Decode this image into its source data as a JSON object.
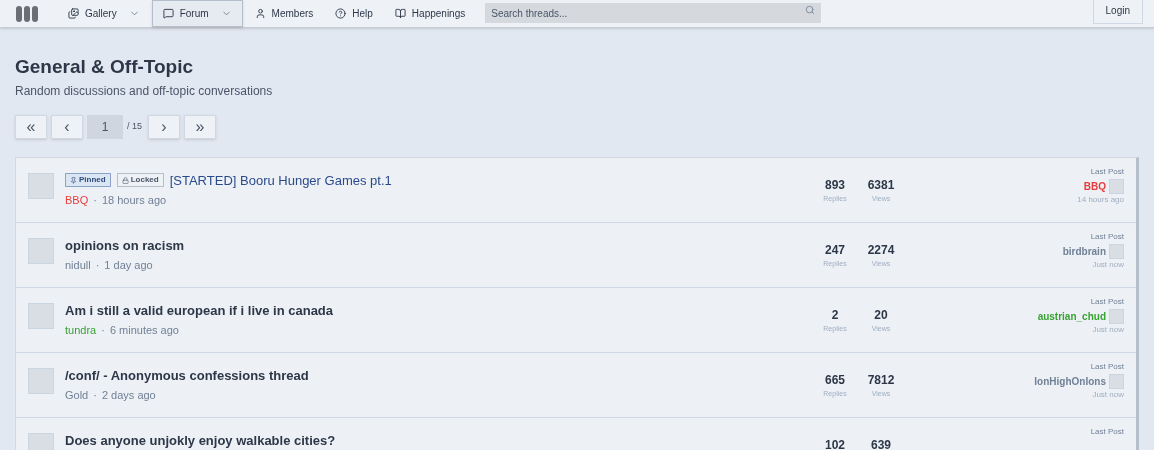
{
  "nav": {
    "items": [
      {
        "label": "Gallery",
        "dropdown": true,
        "selected": false
      },
      {
        "label": "Forum",
        "dropdown": true,
        "selected": true
      },
      {
        "label": "Members",
        "dropdown": false,
        "selected": false
      },
      {
        "label": "Help",
        "dropdown": false,
        "selected": false
      },
      {
        "label": "Happenings",
        "dropdown": false,
        "selected": false
      }
    ],
    "search": {
      "placeholder": "Search threads..."
    },
    "login": "Login"
  },
  "header": {
    "title": "General & Off-Topic",
    "subtitle": "Random discussions and off-topic conversations"
  },
  "pagination": {
    "first": "«",
    "prev": "‹",
    "current": "1",
    "total": "/ 15",
    "next": "›",
    "last": "»"
  },
  "threads": [
    {
      "badges": [
        {
          "kind": "pinned",
          "label": "Pinned"
        },
        {
          "kind": "locked",
          "label": "Locked"
        }
      ],
      "title": "[STARTED] Booru Hunger Games pt.1",
      "unread": false,
      "author": {
        "name": "BBQ",
        "color": "#e53e3e"
      },
      "sep": "·",
      "time": "18 hours ago",
      "replies": "893",
      "replies_label": "Replies",
      "views": "6381",
      "views_label": "Views",
      "last_label": "Last Post",
      "last_user": {
        "name": "BBQ",
        "color": "#e53e3e"
      },
      "last_time": "14 hours ago"
    },
    {
      "title": "opinions on racism",
      "unread": true,
      "author": {
        "name": "nidull",
        "color": "#718096"
      },
      "sep": "·",
      "time": "1 day ago",
      "replies": "247",
      "replies_label": "Replies",
      "views": "2274",
      "views_label": "Views",
      "last_label": "Last Post",
      "last_user": {
        "name": "birdbrain",
        "color": "#718096"
      },
      "last_time": "Just now"
    },
    {
      "title": "Am i still a valid european if i live in canada",
      "unread": true,
      "author": {
        "name": "tundra",
        "color": "#38a132"
      },
      "sep": "·",
      "time": "6 minutes ago",
      "replies": "2",
      "replies_label": "Replies",
      "views": "20",
      "views_label": "Views",
      "last_label": "Last Post",
      "last_user": {
        "name": "austrian_chud",
        "color": "#38a132"
      },
      "last_time": "Just now"
    },
    {
      "title": "/conf/ - Anonymous confessions thread",
      "unread": true,
      "author": {
        "name": "Gold",
        "color": "#718096"
      },
      "sep": "·",
      "time": "2 days ago",
      "replies": "665",
      "replies_label": "Replies",
      "views": "7812",
      "views_label": "Views",
      "last_label": "Last Post",
      "last_user": {
        "name": "IonHighOnIons",
        "color": "#718096"
      },
      "last_time": "Just now"
    },
    {
      "title": "Does anyone unjokly enjoy walkable cities?",
      "unread": true,
      "replies": "102",
      "views": "639",
      "last_label": "Last Post"
    }
  ]
}
